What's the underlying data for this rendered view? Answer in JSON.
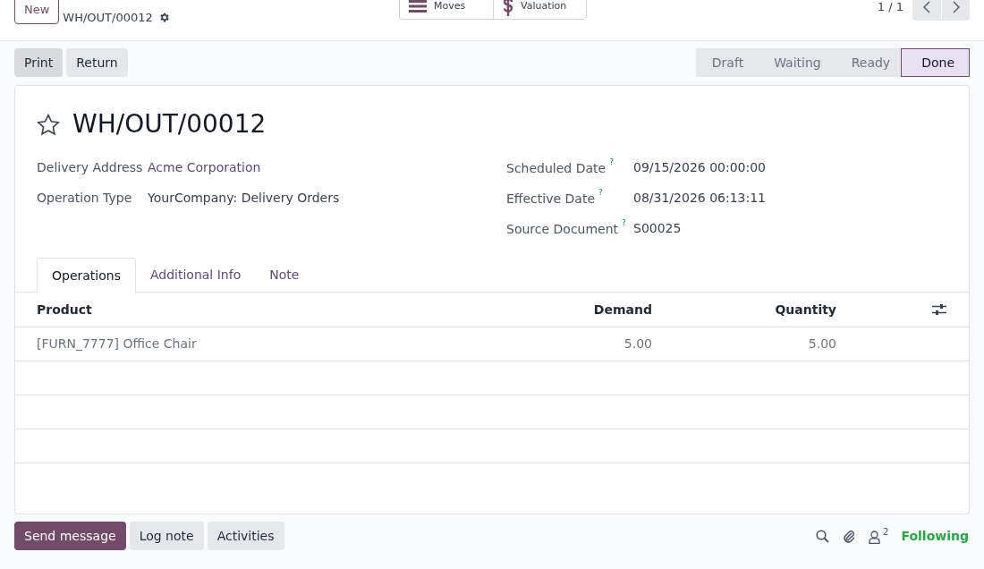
{
  "control_panel": {
    "new_button": "New",
    "record_name": "WH/OUT/00012",
    "smart_buttons": [
      {
        "kind": "list",
        "label": "Moves"
      },
      {
        "kind": "dollar",
        "label": "Valuation"
      }
    ],
    "pager": "1 / 1"
  },
  "action_buttons": [
    "Print",
    "Return"
  ],
  "statuses": [
    {
      "label": "Draft",
      "selected": false
    },
    {
      "label": "Waiting",
      "selected": false
    },
    {
      "label": "Ready",
      "selected": false
    },
    {
      "label": "Done",
      "selected": true
    }
  ],
  "form": {
    "title": "WH/OUT/00012",
    "starred": false,
    "left_fields": [
      {
        "label": "Delivery Address",
        "value": "Acme Corporation",
        "kind": "link"
      },
      {
        "label": "Operation Type",
        "value": "YourCompany: Delivery Orders",
        "kind": "text"
      }
    ],
    "right_fields": [
      {
        "label": "Scheduled Date",
        "help": "?",
        "value": "09/15/2026 00:00:00"
      },
      {
        "label": "Effective Date",
        "help": "?",
        "value": "08/31/2026 06:13:11"
      },
      {
        "label": "Source Document",
        "help": "?",
        "value": "S00025"
      }
    ],
    "tabs": [
      {
        "label": "Operations",
        "selected": true
      },
      {
        "label": "Additional Info",
        "selected": false
      },
      {
        "label": "Note",
        "selected": false
      }
    ],
    "table": {
      "columns": [
        "Product",
        "Demand",
        "Quantity"
      ],
      "rows": [
        [
          "[FURN_7777] Office Chair",
          "5.00",
          "5.00"
        ]
      ]
    }
  },
  "chatter": {
    "buttons": [
      {
        "label": "Send message",
        "kind": "primary"
      },
      {
        "label": "Log note",
        "kind": "secondary"
      },
      {
        "label": "Activities",
        "kind": "secondary"
      }
    ],
    "followers_count": "2",
    "follow_state": "Following"
  }
}
